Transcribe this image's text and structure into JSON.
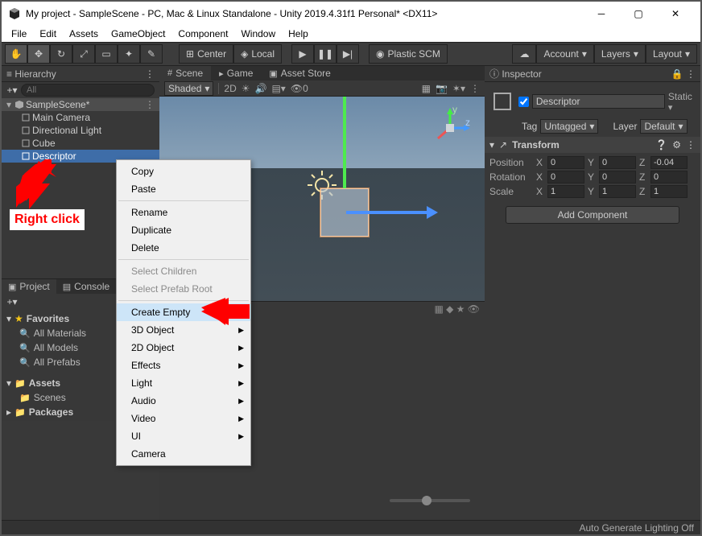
{
  "window": {
    "title": "My project - SampleScene - PC, Mac & Linux Standalone - Unity 2019.4.31f1 Personal* <DX11>"
  },
  "menu": [
    "File",
    "Edit",
    "Assets",
    "GameObject",
    "Component",
    "Window",
    "Help"
  ],
  "toolbar": {
    "center": "Center",
    "local": "Local",
    "plastic": "Plastic SCM",
    "account": "Account",
    "layers": "Layers",
    "layout": "Layout"
  },
  "hierarchy": {
    "title": "Hierarchy",
    "search_ph": "All",
    "scene": "SampleScene*",
    "items": [
      "Main Camera",
      "Directional Light",
      "Cube",
      "Descriptor"
    ]
  },
  "project": {
    "tabs": [
      "Project",
      "Console"
    ],
    "favorites": "Favorites",
    "fav_items": [
      "All Materials",
      "All Models",
      "All Prefabs"
    ],
    "assets": "Assets",
    "asset_items": [
      "Scenes"
    ],
    "packages": "Packages"
  },
  "scene": {
    "tabs": [
      "Scene",
      "Game",
      "Asset Store"
    ],
    "shaded": "Shaded",
    "twod": "2D",
    "axis_y": "y",
    "axis_z": "z"
  },
  "inspector": {
    "title": "Inspector",
    "name": "Descriptor",
    "static": "Static",
    "tag_lbl": "Tag",
    "tag_val": "Untagged",
    "layer_lbl": "Layer",
    "layer_val": "Default",
    "transform": "Transform",
    "position": "Position",
    "rotation": "Rotation",
    "scale": "Scale",
    "pos": {
      "x": "0",
      "y": "0",
      "z": "-0.04"
    },
    "rot": {
      "x": "0",
      "y": "0",
      "z": "0"
    },
    "scl": {
      "x": "1",
      "y": "1",
      "z": "1"
    },
    "add": "Add Component"
  },
  "status": "Auto Generate Lighting Off",
  "context": {
    "items": [
      {
        "label": "Copy"
      },
      {
        "label": "Paste"
      },
      {
        "sep": true
      },
      {
        "label": "Rename"
      },
      {
        "label": "Duplicate"
      },
      {
        "label": "Delete"
      },
      {
        "sep": true
      },
      {
        "label": "Select Children",
        "disabled": true
      },
      {
        "label": "Select Prefab Root",
        "disabled": true
      },
      {
        "sep": true
      },
      {
        "label": "Create Empty",
        "hover": true
      },
      {
        "label": "3D Object",
        "sub": true
      },
      {
        "label": "2D Object",
        "sub": true
      },
      {
        "label": "Effects",
        "sub": true
      },
      {
        "label": "Light",
        "sub": true
      },
      {
        "label": "Audio",
        "sub": true
      },
      {
        "label": "Video",
        "sub": true
      },
      {
        "label": "UI",
        "sub": true
      },
      {
        "label": "Camera"
      }
    ]
  },
  "annotation": "Right click"
}
